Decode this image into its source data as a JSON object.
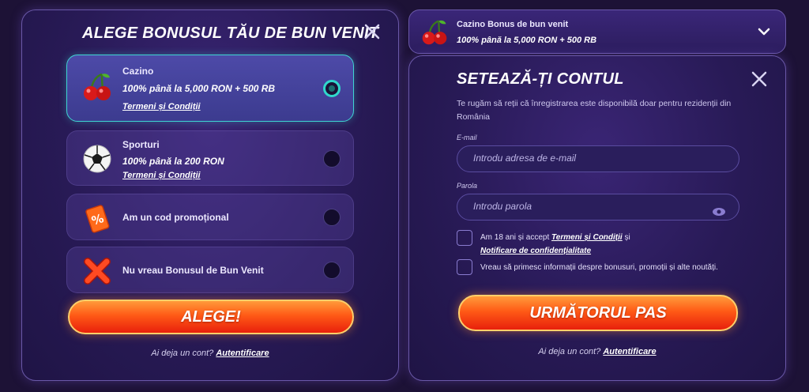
{
  "left_panel": {
    "title": "ALEGE BONUSUL TĂU DE BUN VENIT",
    "options": [
      {
        "label": "Cazino",
        "subtitle": "100% până la 5,000 RON + 500 RB",
        "terms": "Termeni și Condiții",
        "selected": true,
        "icon": "cherries-icon"
      },
      {
        "label": "Sporturi",
        "subtitle": "100% până la 200 RON",
        "terms": "Termeni și Condiții",
        "selected": false,
        "icon": "soccer-ball-icon"
      },
      {
        "label": "Am un cod promoțional",
        "selected": false,
        "icon": "promo-ticket-icon"
      },
      {
        "label": "Nu vreau Bonusul de Bun Venit",
        "selected": false,
        "icon": "red-x-icon"
      }
    ],
    "cta": "ALEGE!",
    "footer_text": "Ai deja un cont?",
    "footer_link": "Autentificare"
  },
  "header": {
    "title": "Cazino Bonus de bun venit",
    "subtitle": "100% până la 5,000 RON + 500 RB",
    "icon": "cherries-icon"
  },
  "right_panel": {
    "title": "SETEAZĂ-ȚI CONTUL",
    "notice": "Te rugăm să reții că înregistrarea este disponibilă doar pentru rezidenții din România",
    "email_label": "E-mail",
    "email_placeholder": "Introdu adresa de e-mail",
    "password_label": "Parola",
    "password_placeholder": "Introdu parola",
    "age_check_text": "Am 18 ani și accept",
    "age_check_link1": "Termeni și Condiții",
    "age_check_and": "și",
    "age_check_link2": "Notificare de confidențialitate",
    "marketing_check_text": "Vreau să primesc informații despre bonusuri, promoții și alte noutăți.",
    "cta": "URMĂTORUL PAS",
    "footer_text": "Ai deja un cont?",
    "footer_link": "Autentificare"
  },
  "colors": {
    "accent_teal": "#30d8cc",
    "cta_orange": "#ff5a16",
    "panel_bg": "#281a56"
  }
}
